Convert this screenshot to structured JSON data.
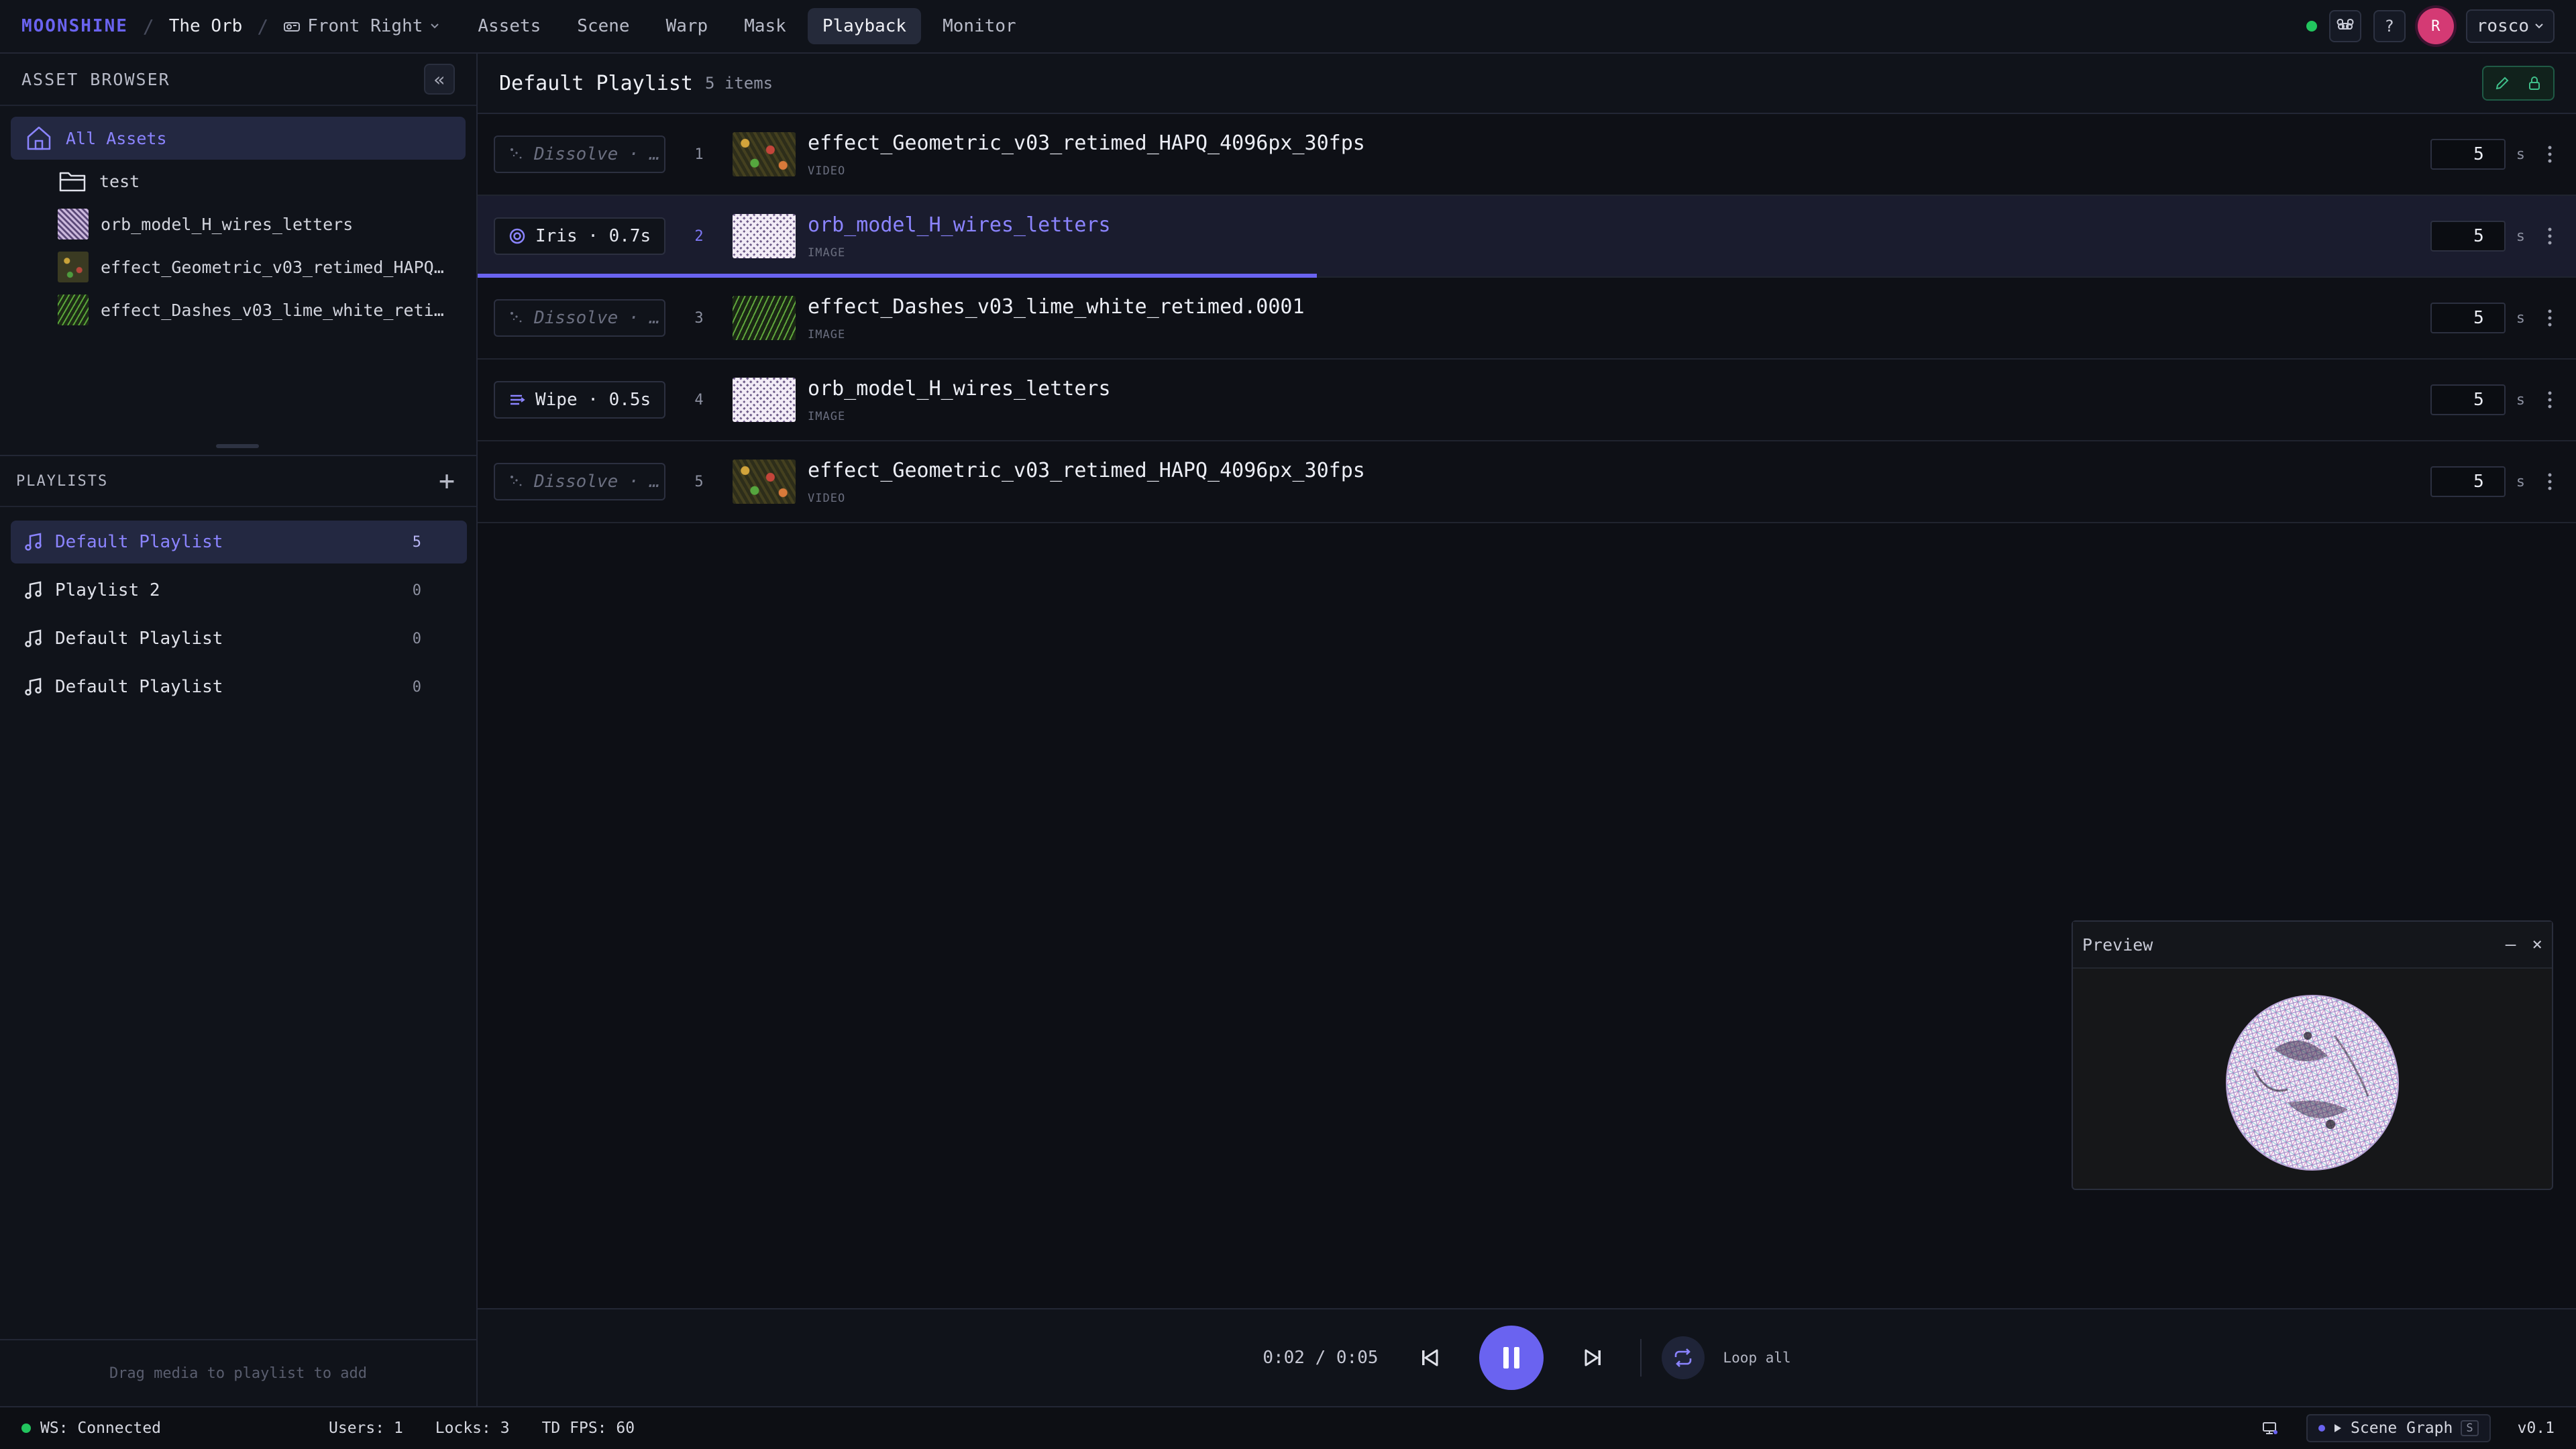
{
  "topbar": {
    "brand": "MOONSHINE",
    "project": "The Orb",
    "view": "Front Right",
    "tabs": [
      {
        "label": "Assets"
      },
      {
        "label": "Scene"
      },
      {
        "label": "Warp"
      },
      {
        "label": "Mask"
      },
      {
        "label": "Playback",
        "active": true
      },
      {
        "label": "Monitor"
      }
    ],
    "help_label": "?",
    "avatar_initial": "R",
    "user_name": "rosco"
  },
  "asset_browser": {
    "title": "ASSET BROWSER",
    "collapse_label": "«",
    "items": [
      {
        "label": "All Assets",
        "icon": "home-icon",
        "active": true
      },
      {
        "label": "test",
        "icon": "folder-icon"
      },
      {
        "label": "orb_model_H_wires_letters",
        "icon": "image-thumbnail"
      },
      {
        "label": "effect_Geometric_v03_retimed_HAPQ_4096px_30fps",
        "icon": "video-thumbnail"
      },
      {
        "label": "effect_Dashes_v03_lime_white_retimed.0001",
        "icon": "image-thumbnail"
      }
    ]
  },
  "playlists": {
    "title": "PLAYLISTS",
    "add_label": "+",
    "items": [
      {
        "label": "Default Playlist",
        "count": "5",
        "active": true
      },
      {
        "label": "Playlist 2",
        "count": "0"
      },
      {
        "label": "Default Playlist",
        "count": "0"
      },
      {
        "label": "Default Playlist",
        "count": "0"
      }
    ],
    "footer_hint": "Drag media to playlist to add"
  },
  "main": {
    "title": "Default Playlist",
    "count_label": "5 items",
    "rows": [
      {
        "index": "1",
        "transition": "Dissolve · …",
        "transition_muted": true,
        "name": "effect_Geometric_v03_retimed_HAPQ_4096px_30fps",
        "type": "VIDEO",
        "duration": "5",
        "unit": "s"
      },
      {
        "index": "2",
        "transition": "Iris · 0.7s",
        "transition_muted": false,
        "name": "orb_model_H_wires_letters",
        "type": "IMAGE",
        "duration": "5",
        "unit": "s",
        "current": true,
        "progress": 0.4
      },
      {
        "index": "3",
        "transition": "Dissolve · …",
        "transition_muted": true,
        "name": "effect_Dashes_v03_lime_white_retimed.0001",
        "type": "IMAGE",
        "duration": "5",
        "unit": "s"
      },
      {
        "index": "4",
        "transition": "Wipe · 0.5s",
        "transition_muted": false,
        "name": "orb_model_H_wires_letters",
        "type": "IMAGE",
        "duration": "5",
        "unit": "s"
      },
      {
        "index": "5",
        "transition": "Dissolve · …",
        "transition_muted": true,
        "name": "effect_Geometric_v03_retimed_HAPQ_4096px_30fps",
        "type": "VIDEO",
        "duration": "5",
        "unit": "s"
      }
    ]
  },
  "preview": {
    "title": "Preview",
    "minimize_label": "–",
    "close_label": "×"
  },
  "transport": {
    "time": "0:02 / 0:05",
    "loop_label": "Loop all"
  },
  "statusbar": {
    "ws": "WS: Connected",
    "users": "Users: 1",
    "locks": "Locks: 3",
    "fps": "TD FPS: 60",
    "scene_graph": "Scene Graph",
    "scene_graph_key": "S",
    "version": "v0.1"
  },
  "colors": {
    "accent": "#6a63f0",
    "status_ok": "#22c55e",
    "avatar": "#d43a74"
  }
}
